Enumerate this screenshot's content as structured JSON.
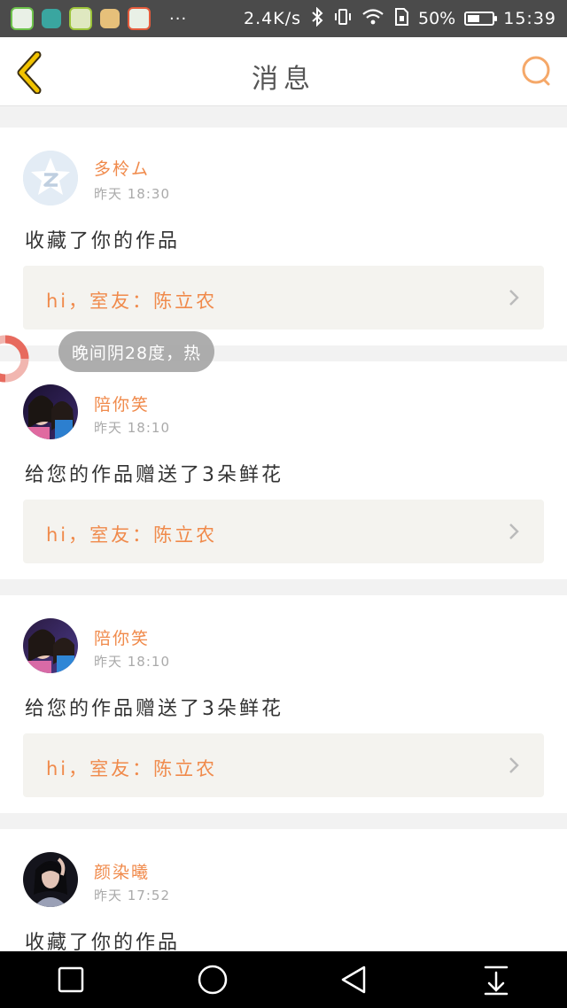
{
  "status_bar": {
    "network_speed": "2.4K/s",
    "battery_percent": "50%",
    "battery_level": 0.5,
    "time": "15:39",
    "notification_more": "···"
  },
  "header": {
    "title": "消息",
    "back_icon": "chevron-left-icon",
    "search_icon": "search-icon"
  },
  "messages": [
    {
      "name": "多柃ム",
      "time": "昨天 18:30",
      "action": "收藏了你的作品",
      "quote": "hi，室友：陈立农"
    },
    {
      "name": "陪你笑",
      "time": "昨天 18:10",
      "action": "给您的作品赠送了3朵鲜花",
      "quote": "hi，室友：陈立农"
    },
    {
      "name": "陪你笑",
      "time": "昨天 18:10",
      "action": "给您的作品赠送了3朵鲜花",
      "quote": "hi，室友：陈立农"
    },
    {
      "name": "颜染曦",
      "time": "昨天 17:52",
      "action": "收藏了你的作品"
    }
  ],
  "toast": {
    "text": "晚间阴28度，热"
  },
  "colors": {
    "accent": "#f08a4b",
    "back_icon": "#e8b400",
    "status_bar": "#4b4b4b"
  }
}
